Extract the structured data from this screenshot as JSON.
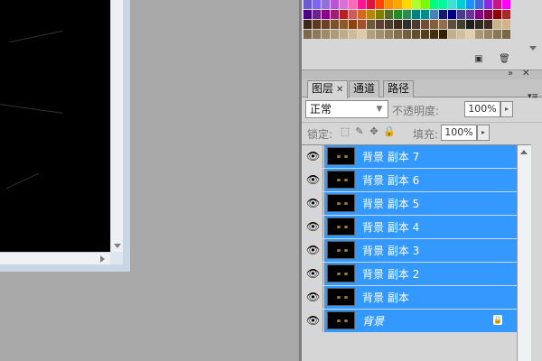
{
  "colors": {
    "selection": "#3399ff",
    "workspace": "#a8a8a8",
    "panel": "#d6d6d6"
  },
  "swatches": {
    "row1": [
      "#6a5acd",
      "#7b68ee",
      "#9370db",
      "#ba55d3",
      "#da70d6",
      "#ff69b4",
      "#ff1493",
      "#dc143c",
      "#ff4500",
      "#ff8c00",
      "#ffa500",
      "#ffd700",
      "#adff2f",
      "#7cfc00",
      "#00ff7f",
      "#00fa9a",
      "#40e0d0",
      "#00ced1",
      "#1e90ff",
      "#4169e1",
      "#8a2be2",
      "#c71585",
      "#ff00ff"
    ],
    "row2": [
      "#4b0082",
      "#6b238e",
      "#8b008b",
      "#a0206f",
      "#b22222",
      "#cd5c5c",
      "#d2691e",
      "#b8860b",
      "#808000",
      "#556b2f",
      "#228b22",
      "#2e8b57",
      "#008080",
      "#008b8b",
      "#4682b4",
      "#191970",
      "#000080",
      "#483d8b",
      "#663399",
      "#800080",
      "#800040",
      "#8b0000",
      "#a52a2a"
    ],
    "row3": [
      "#3b2a1a",
      "#5a3a22",
      "#6b4226",
      "#7a5230",
      "#8b5a2b",
      "#8b4513",
      "#a0522d",
      "#6b5b3a",
      "#5c4033",
      "#4a3b2a",
      "#3d2b1f",
      "#2f2f2f",
      "#4f3a2f",
      "#6f4e37",
      "#7f5f3f",
      "#8f6f4f",
      "#5f4f3f",
      "#3f3f2f",
      "#1f1f1f",
      "#2f2a20",
      "#402a20",
      "#c8b48c",
      "#d2b48c"
    ],
    "row4": [
      "#7a6a50",
      "#8c7a5a",
      "#9c8a6a",
      "#ac9a7a",
      "#bcaa8a",
      "#ccba9a",
      "#dccaaa",
      "#b0a080",
      "#a09070",
      "#908060",
      "#807050",
      "#706040",
      "#605030",
      "#504020",
      "#403010",
      "#302000",
      "#c0b090",
      "#d0c0a0",
      "#e0d0b0",
      "#a89878",
      "#988868",
      "#887858",
      "#786848"
    ]
  },
  "layers_panel": {
    "tabs": [
      "图层",
      "通道",
      "路径"
    ],
    "blend_mode": "正常",
    "opacity_label": "不透明度:",
    "opacity_value": "100%",
    "lock_label": "锁定:",
    "fill_label": "填充:",
    "fill_value": "100%",
    "layers": [
      {
        "name": "背景 副本 7",
        "italic": false,
        "locked": false
      },
      {
        "name": "背景 副本 6",
        "italic": false,
        "locked": false
      },
      {
        "name": "背景 副本 5",
        "italic": false,
        "locked": false
      },
      {
        "name": "背景 副本 4",
        "italic": false,
        "locked": false
      },
      {
        "name": "背景 副本 3",
        "italic": false,
        "locked": false
      },
      {
        "name": "背景 副本 2",
        "italic": false,
        "locked": false
      },
      {
        "name": "背景 副本",
        "italic": false,
        "locked": false
      },
      {
        "name": "背景",
        "italic": true,
        "locked": true
      }
    ]
  }
}
